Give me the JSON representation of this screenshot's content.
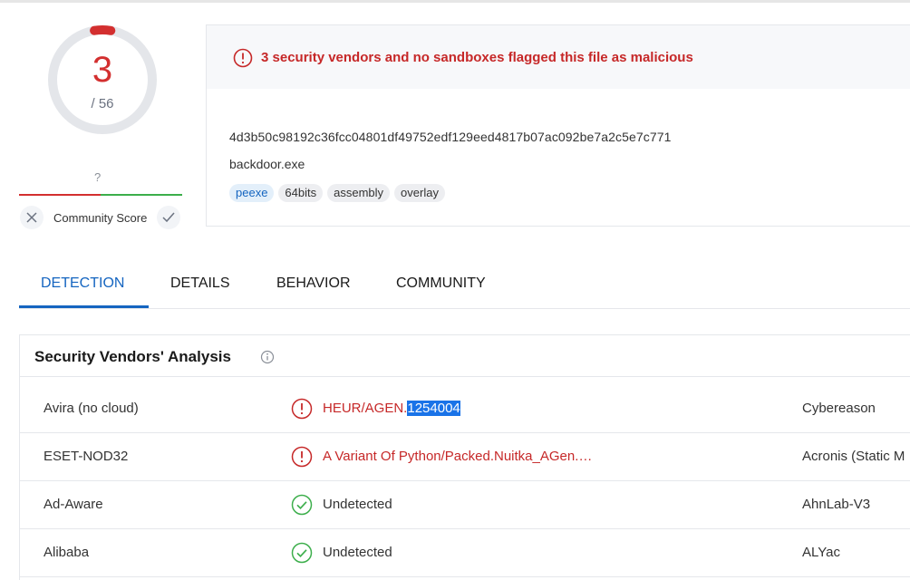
{
  "score": {
    "detections": "3",
    "total": "/ 56",
    "detection_fraction": 0.054,
    "ring_color": "#d32f2f"
  },
  "community": {
    "unknown": "?",
    "label": "Community Score"
  },
  "summary": {
    "alert": "3 security vendors and no sandboxes flagged this file as malicious",
    "hash": "4d3b50c98192c36fcc04801df49752edf129eed4817b07ac092be7a2c5e7c771",
    "filename": "backdoor.exe",
    "tags": [
      "peexe",
      "64bits",
      "assembly",
      "overlay"
    ]
  },
  "tabs": [
    "DETECTION",
    "DETAILS",
    "BEHAVIOR",
    "COMMUNITY"
  ],
  "vendors": {
    "title": "Security Vendors' Analysis",
    "rows": [
      {
        "vendor": "Avira (no cloud)",
        "result_prefix": "HEUR/AGEN.",
        "result_selected": "1254004",
        "malicious": true,
        "vendor2": "Cybereason"
      },
      {
        "vendor": "ESET-NOD32",
        "result_prefix": "A Variant Of Python/Packed.Nuitka_AGen.…",
        "result_selected": "",
        "malicious": true,
        "vendor2": "Acronis (Static M"
      },
      {
        "vendor": "Ad-Aware",
        "result_prefix": "Undetected",
        "result_selected": "",
        "malicious": false,
        "vendor2": "AhnLab-V3"
      },
      {
        "vendor": "Alibaba",
        "result_prefix": "Undetected",
        "result_selected": "",
        "malicious": false,
        "vendor2": "ALYac"
      }
    ]
  }
}
